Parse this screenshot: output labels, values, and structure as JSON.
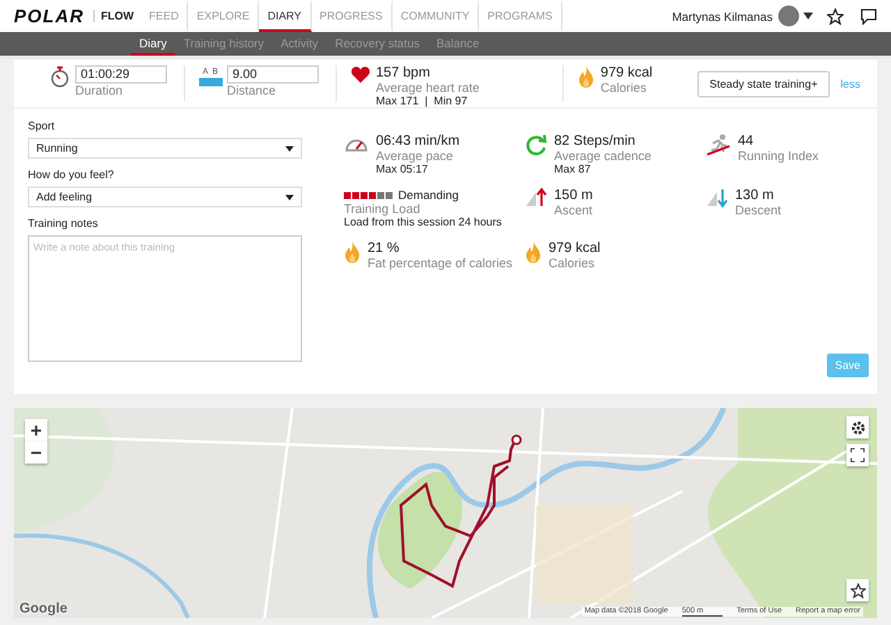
{
  "top_nav": {
    "logo": "POLAR",
    "product": "FLOW",
    "items": [
      {
        "label": "FEED",
        "selected": false
      },
      {
        "label": "EXPLORE",
        "selected": false
      },
      {
        "label": "DIARY",
        "selected": true
      },
      {
        "label": "PROGRESS",
        "selected": false
      },
      {
        "label": "COMMUNITY",
        "selected": false
      },
      {
        "label": "PROGRAMS",
        "selected": false
      }
    ],
    "user": "Martynas Kilmanas"
  },
  "sub_nav": [
    {
      "label": "Diary",
      "selected": true
    },
    {
      "label": "Training history",
      "selected": false
    },
    {
      "label": "Activity",
      "selected": false
    },
    {
      "label": "Recovery status",
      "selected": false
    },
    {
      "label": "Balance",
      "selected": false
    }
  ],
  "summary": {
    "duration": {
      "value": "01:00:29",
      "label": "Duration"
    },
    "distance": {
      "value": "9.00",
      "label": "Distance",
      "a": "A",
      "b": "B"
    },
    "heart_rate": {
      "value": "157 bpm",
      "label": "Average heart rate",
      "detail": "Max 171  |  Min 97"
    },
    "calories": {
      "value": "979 kcal",
      "label": "Calories"
    },
    "button": "Steady state training+",
    "link": "less"
  },
  "form": {
    "sport_label": "Sport",
    "sport": "Running",
    "feeling_label": "How do you feel?",
    "feeling": "Add feeling",
    "notes_label": "Training notes",
    "notes_placeholder": "Write a note about this training"
  },
  "metrics": [
    {
      "kind": "pace",
      "value": "06:43 min/km",
      "label": "Average pace",
      "detail": "Max 05:17"
    },
    {
      "kind": "cadence",
      "value": "82 Steps/min",
      "label": "Average cadence",
      "detail": "Max 87"
    },
    {
      "kind": "index",
      "value": "44",
      "label": "Running Index"
    },
    {
      "kind": "load",
      "value": "Demanding",
      "label": "Training Load",
      "detail": "Load from this session 24 hours",
      "bars": [
        true,
        true,
        true,
        true,
        false,
        false
      ]
    },
    {
      "kind": "ascent",
      "value": "150 m",
      "label": "Ascent"
    },
    {
      "kind": "descent",
      "value": "130 m",
      "label": "Descent"
    },
    {
      "kind": "fat",
      "value": "21 %",
      "label": "Fat percentage of calories"
    },
    {
      "kind": "calories",
      "value": "979 kcal",
      "label": "Calories"
    }
  ],
  "save_button": "Save",
  "map": {
    "zoom_in": "+",
    "zoom_out": "−",
    "logo": "Google",
    "attribution": "Map data ©2018 Google",
    "scale": "500 m",
    "terms": "Terms of Use",
    "report": "Report a map error"
  }
}
